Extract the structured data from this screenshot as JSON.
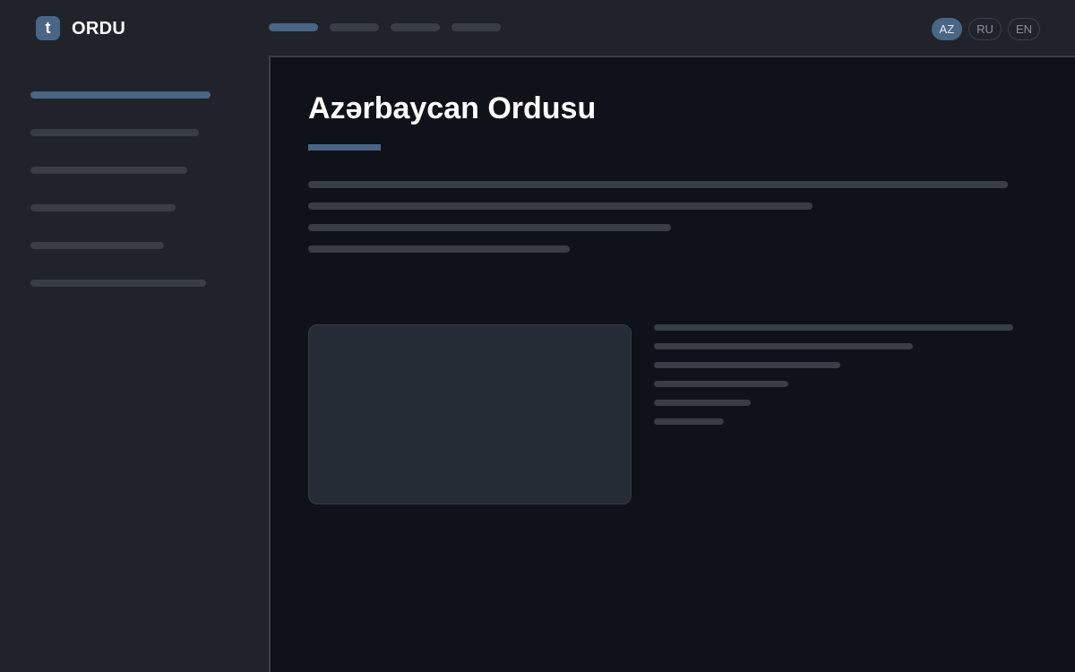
{
  "header": {
    "logo_letter": "t",
    "brand": "ORDU",
    "nav_items": [
      {
        "state": "active"
      },
      {
        "state": "inactive"
      },
      {
        "state": "inactive"
      },
      {
        "state": "inactive"
      }
    ],
    "languages": [
      {
        "label": "AZ",
        "active": true
      },
      {
        "label": "RU",
        "active": false
      },
      {
        "label": "EN",
        "active": false
      }
    ]
  },
  "main": {
    "title": "Azərbaycan Ordusu"
  },
  "colors": {
    "accent": "#4a6585",
    "panel": "#20232a",
    "background": "#0f1218",
    "placeholder": "#393d46",
    "card": "#262c35"
  }
}
